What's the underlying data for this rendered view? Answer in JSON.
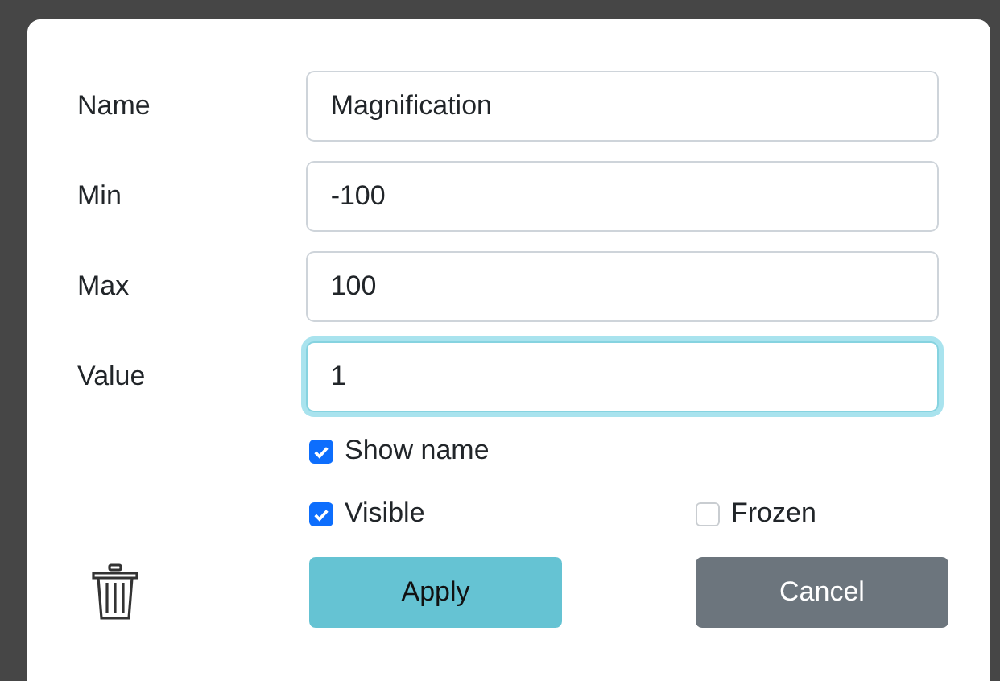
{
  "fields": [
    {
      "label": "Name",
      "value": "Magnification",
      "focused": false
    },
    {
      "label": "Min",
      "value": "-100",
      "focused": false
    },
    {
      "label": "Max",
      "value": "100",
      "focused": false
    },
    {
      "label": "Value",
      "value": "1",
      "focused": true
    }
  ],
  "show_name": {
    "label": "Show name",
    "checked": true
  },
  "visible": {
    "label": "Visible",
    "checked": true
  },
  "frozen": {
    "label": "Frozen",
    "checked": false
  },
  "buttons": [
    {
      "label": "Apply",
      "kind": "primary"
    },
    {
      "label": "Cancel",
      "kind": "secondary"
    }
  ]
}
